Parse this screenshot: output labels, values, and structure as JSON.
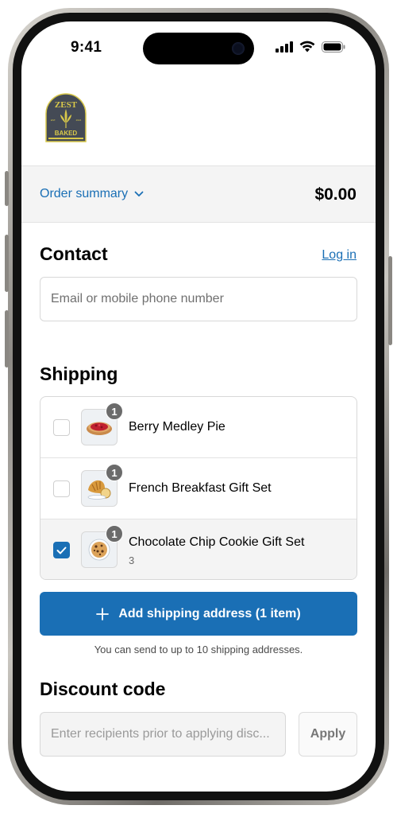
{
  "status_bar": {
    "time": "9:41"
  },
  "brand": {
    "logo_top": "ZEST",
    "logo_bottom": "BAKED",
    "logo_left_tiny": "EST.",
    "logo_right_tiny": "2024",
    "logo_color": "#444a55",
    "logo_accent": "#d8c84a"
  },
  "order_summary": {
    "toggle_label": "Order summary",
    "total": "$0.00"
  },
  "contact": {
    "heading": "Contact",
    "login_label": "Log in",
    "email_placeholder": "Email or mobile phone number"
  },
  "shipping": {
    "heading": "Shipping",
    "items": [
      {
        "name": "Berry Medley Pie",
        "quantity": "1",
        "selected": false,
        "icon": "pie-icon"
      },
      {
        "name": "French Breakfast Gift Set",
        "quantity": "1",
        "selected": false,
        "icon": "croissant-icon"
      },
      {
        "name": "Chocolate Chip Cookie Gift Set",
        "quantity": "1",
        "subtext": "3",
        "selected": true,
        "icon": "cookie-icon"
      }
    ],
    "add_button_label": "Add shipping address (1 item)",
    "helper_text": "You can send to up to 10 shipping addresses."
  },
  "discount": {
    "heading": "Discount code",
    "input_placeholder": "Enter recipients prior to applying disc...",
    "apply_label": "Apply"
  },
  "colors": {
    "accent": "#1a6fb5",
    "summary_bg": "#f4f4f4",
    "badge": "#6b6b6b"
  }
}
